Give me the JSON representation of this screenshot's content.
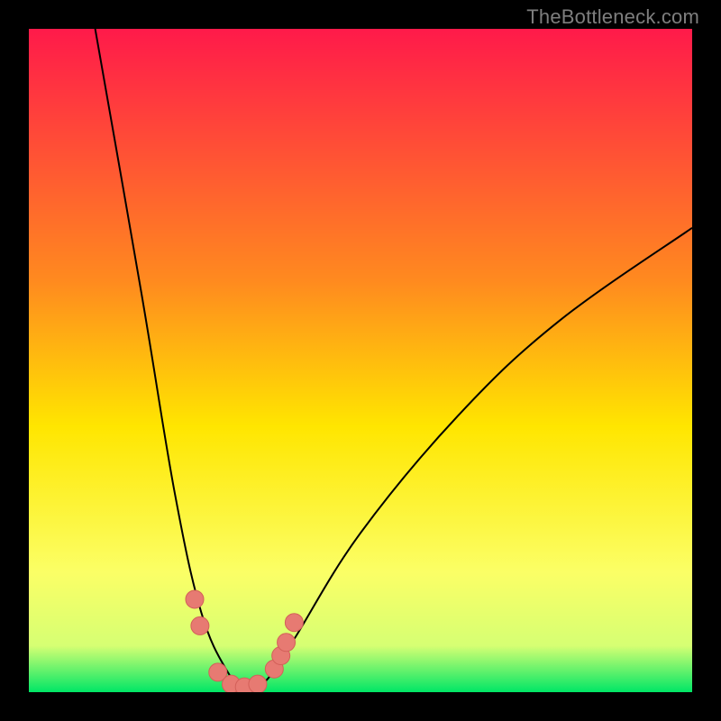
{
  "watermark": "TheBottleneck.com",
  "colors": {
    "frame_background": "#000000",
    "gradient_top": "#ff1a4a",
    "gradient_mid1": "#ff8a1f",
    "gradient_mid2": "#ffe600",
    "gradient_mid3": "#fbff66",
    "gradient_mid4": "#d6ff73",
    "gradient_bottom": "#00e666",
    "curve": "#000000",
    "marker_fill": "#e77a72",
    "marker_stroke": "#d36059"
  },
  "chart_data": {
    "type": "line",
    "title": "",
    "xlabel": "",
    "ylabel": "",
    "xlim": [
      0,
      100
    ],
    "ylim": [
      0,
      100
    ],
    "curve_left": [
      {
        "x": 10,
        "y": 100
      },
      {
        "x": 17,
        "y": 60
      },
      {
        "x": 22,
        "y": 30
      },
      {
        "x": 26,
        "y": 12
      },
      {
        "x": 30,
        "y": 3
      },
      {
        "x": 33,
        "y": 0
      }
    ],
    "curve_right": [
      {
        "x": 33,
        "y": 0
      },
      {
        "x": 36,
        "y": 2
      },
      {
        "x": 40,
        "y": 8
      },
      {
        "x": 50,
        "y": 24
      },
      {
        "x": 65,
        "y": 42
      },
      {
        "x": 80,
        "y": 56
      },
      {
        "x": 100,
        "y": 70
      }
    ],
    "markers": [
      {
        "x": 25.0,
        "y": 14.0
      },
      {
        "x": 25.8,
        "y": 10.0
      },
      {
        "x": 28.5,
        "y": 3.0
      },
      {
        "x": 30.5,
        "y": 1.2
      },
      {
        "x": 32.5,
        "y": 0.8
      },
      {
        "x": 34.5,
        "y": 1.2
      },
      {
        "x": 37.0,
        "y": 3.5
      },
      {
        "x": 38.0,
        "y": 5.5
      },
      {
        "x": 38.8,
        "y": 7.5
      },
      {
        "x": 40.0,
        "y": 10.5
      }
    ],
    "gradient_stops": [
      {
        "offset": 0.0,
        "color_key": "gradient_top"
      },
      {
        "offset": 0.38,
        "color_key": "gradient_mid1"
      },
      {
        "offset": 0.6,
        "color_key": "gradient_mid2"
      },
      {
        "offset": 0.82,
        "color_key": "gradient_mid3"
      },
      {
        "offset": 0.93,
        "color_key": "gradient_mid4"
      },
      {
        "offset": 1.0,
        "color_key": "gradient_bottom"
      }
    ]
  }
}
